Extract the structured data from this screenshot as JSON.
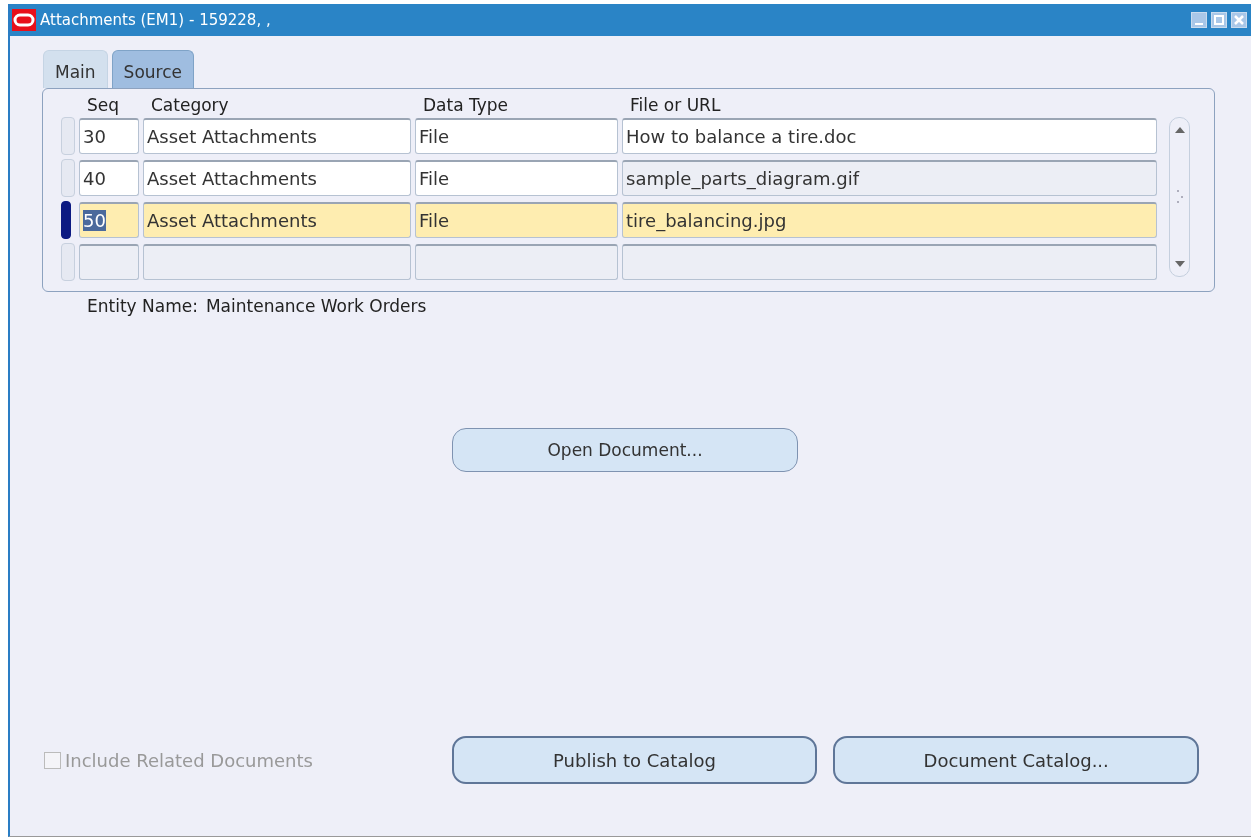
{
  "window": {
    "title": "Attachments (EM1) - 159228, ,"
  },
  "tabs": [
    {
      "label": "Main",
      "selected": false
    },
    {
      "label": "Source",
      "selected": true
    }
  ],
  "table": {
    "columns": [
      "Seq",
      "Category",
      "Data Type",
      "File or URL"
    ],
    "rows": [
      {
        "kind": "record",
        "seq": "30",
        "category": "Asset Attachments",
        "data_type": "File",
        "file": "How to balance a tire.doc",
        "selected": false,
        "file_disabled": false
      },
      {
        "kind": "record",
        "seq": "40",
        "category": "Asset Attachments",
        "data_type": "File",
        "file": "sample_parts_diagram.gif",
        "selected": false,
        "file_disabled": true
      },
      {
        "kind": "record",
        "seq": "50",
        "category": "Asset Attachments",
        "data_type": "File",
        "file": "tire_balancing.jpg",
        "selected": true,
        "file_disabled": false
      },
      {
        "kind": "blank",
        "selected": false
      }
    ]
  },
  "entity": {
    "label": "Entity Name:",
    "value": "Maintenance Work Orders"
  },
  "open_button": "Open Document...",
  "include_related": {
    "label": "Include Related Documents",
    "checked": false,
    "disabled": true
  },
  "buttons": [
    "Publish to Catalog",
    "Document Catalog..."
  ]
}
